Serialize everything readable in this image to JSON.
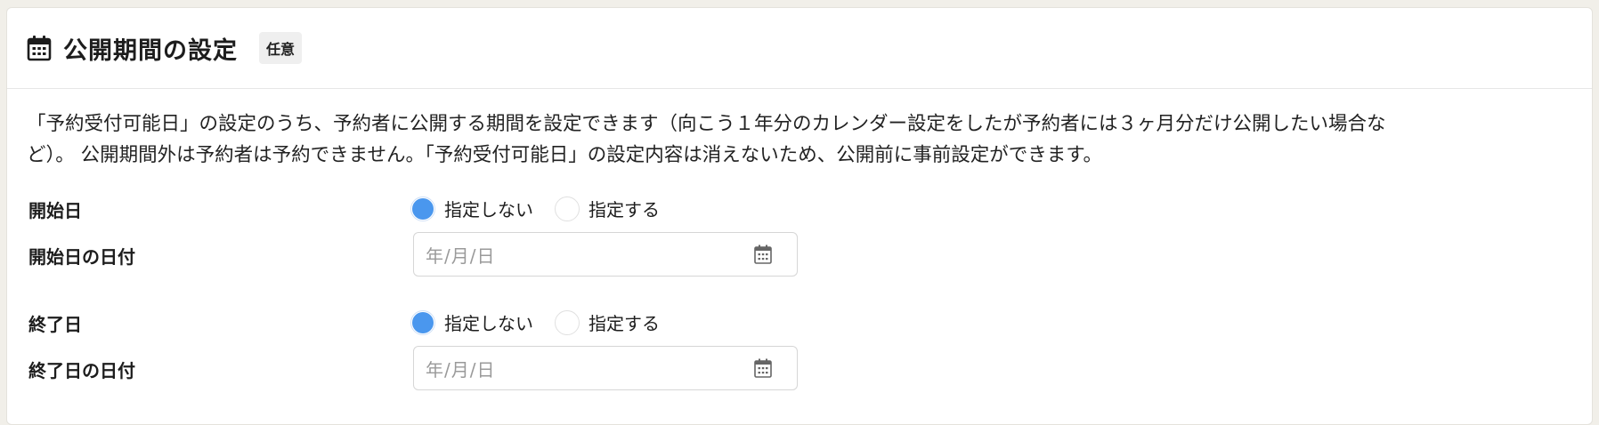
{
  "section": {
    "title": "公開期間の設定",
    "badge": "任意",
    "description_line1": "「予約受付可能日」の設定のうち、予約者に公開する期間を設定できます（向こう１年分のカレンダー設定をしたが予約者には３ヶ月分だけ公開したい場合な",
    "description_line2": "ど）。 公開期間外は予約者は予約できません。「予約受付可能日」の設定内容は消えないため、公開前に事前設定ができます。"
  },
  "start": {
    "label": "開始日",
    "options": [
      "指定しない",
      "指定する"
    ],
    "selected": "指定しない",
    "date_label": "開始日の日付",
    "date_placeholder": "年/月/日"
  },
  "end": {
    "label": "終了日",
    "options": [
      "指定しない",
      "指定する"
    ],
    "selected": "指定しない",
    "date_label": "終了日の日付",
    "date_placeholder": "年/月/日"
  },
  "icons": {
    "header": "calendar-icon",
    "date_picker": "calendar-icon"
  },
  "colors": {
    "radio_selected": "#4a97ee",
    "page_background": "#f1efe9"
  }
}
